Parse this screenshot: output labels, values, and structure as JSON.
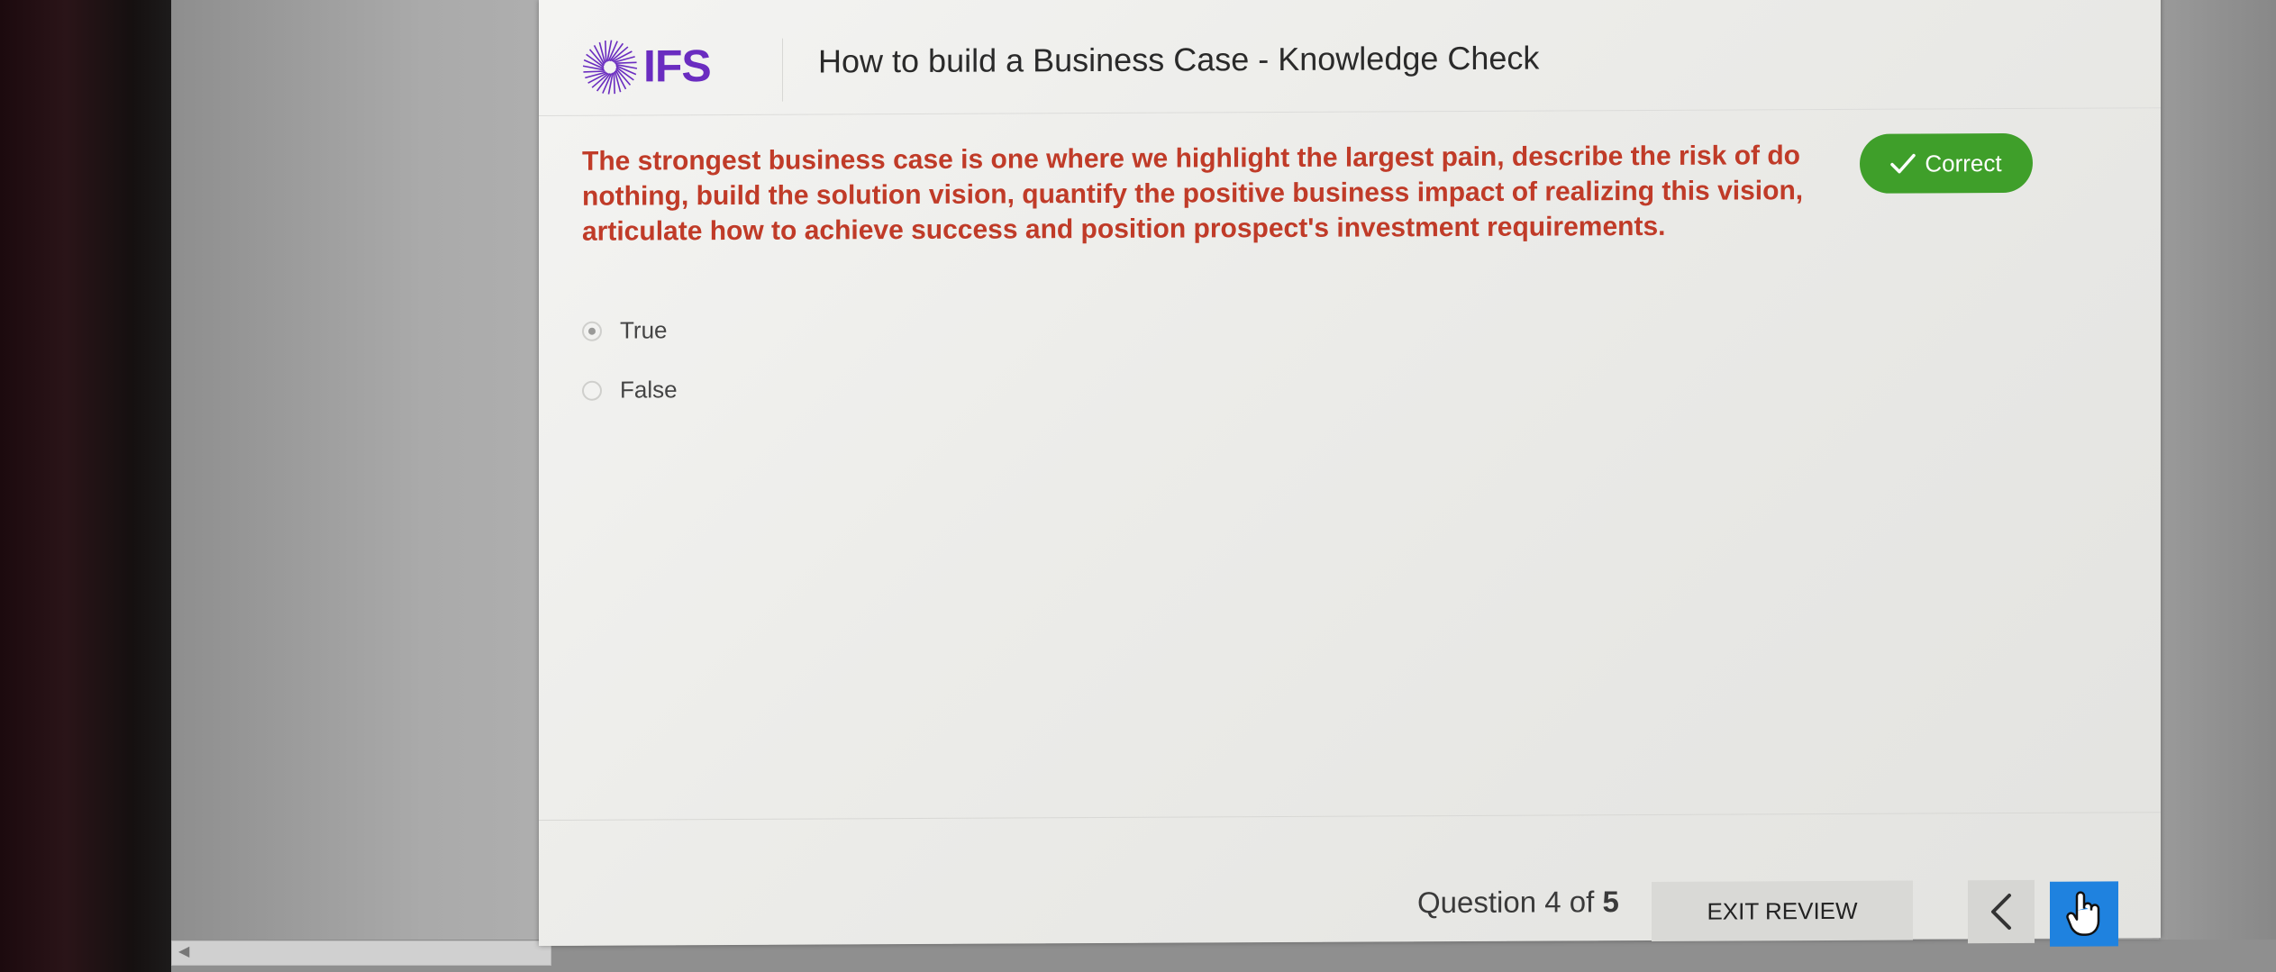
{
  "header": {
    "logo_text": "IFS",
    "course_title": "How to build a Business Case - Knowledge Check"
  },
  "question": {
    "text": "The strongest business case is one where we highlight the largest pain, describe the risk of do nothing, build the solution vision, quantify the positive business impact of realizing this vision, articulate how to achieve success and position prospect's investment requirements.",
    "status_label": "Correct",
    "options": [
      {
        "label": "True",
        "selected": true
      },
      {
        "label": "False",
        "selected": false
      }
    ]
  },
  "footer": {
    "counter_prefix": "Question 4 of",
    "counter_total": "5",
    "exit_review_label": "EXIT REVIEW"
  },
  "colors": {
    "question_text": "#c03b28",
    "correct_badge": "#3f9f2a",
    "logo": "#6a2cc0",
    "next_button": "#1f82df"
  },
  "icons": {
    "logo": "ifs-burst-logo-icon",
    "status": "checkmark-icon",
    "prev": "chevron-left-icon",
    "next": "hand-pointer-icon"
  }
}
